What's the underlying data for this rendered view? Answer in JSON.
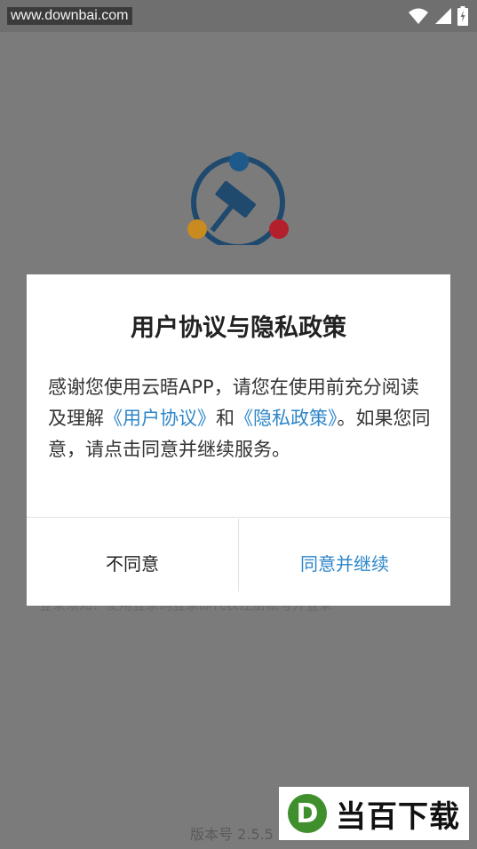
{
  "status_bar": {
    "watermark": "www.downbai.com",
    "icons": [
      "wifi-icon",
      "signal-icon",
      "battery-icon"
    ]
  },
  "background": {
    "hint_text": "登录须知：使用登录码登录即代表注册账号并登录",
    "version_label": "版本号 2.5.5"
  },
  "dialog": {
    "title": "用户协议与隐私政策",
    "body_prefix": "感谢您使用云晤APP，请您在使用前充分阅读及理解",
    "link_user_agreement": "《用户协议》",
    "body_and": "和",
    "link_privacy_policy": "《隐私政策》",
    "body_suffix": "。如果您同意，请点击同意并继续服务。",
    "disagree_label": "不同意",
    "agree_label": "同意并继续"
  },
  "watermark_badge": {
    "letter": "D",
    "text": "当百下载"
  },
  "colors": {
    "link": "#2d86c9",
    "logo_ring": "#1f4a6e",
    "logo_dot_blue": "#1d5a8a",
    "logo_dot_gold": "#c98b1f",
    "logo_dot_red": "#b3202c"
  }
}
